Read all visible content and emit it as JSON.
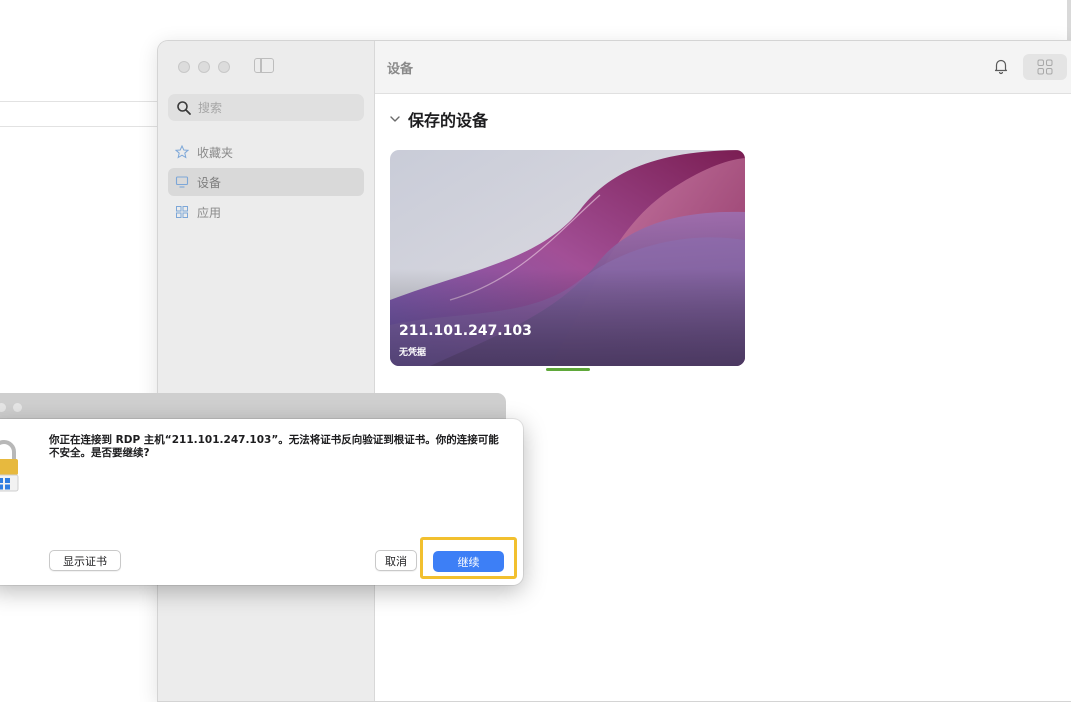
{
  "app": {
    "toolbar": {
      "title": "设备"
    },
    "search": {
      "placeholder": "搜索"
    },
    "sidebar": {
      "items": [
        {
          "label": "收藏夹",
          "icon": "star-icon",
          "active": false
        },
        {
          "label": "设备",
          "icon": "monitor-icon",
          "active": true
        },
        {
          "label": "应用",
          "icon": "apps-icon",
          "active": false
        }
      ]
    },
    "section": {
      "title": "保存的设备",
      "expanded": true
    },
    "device": {
      "name": "211.101.247.103",
      "credentials": "无凭据"
    }
  },
  "dialog": {
    "message": "你正在连接到 RDP 主机“211.101.247.103”。无法将证书反向验证到根证书。你的连接可能不安全。是否要继续?",
    "show_certificate_label": "显示证书",
    "cancel_label": "取消",
    "continue_label": "继续"
  },
  "colors": {
    "accent": "#3d7ff6",
    "highlight": "#f2c02f",
    "indicator": "#5fa83a"
  }
}
